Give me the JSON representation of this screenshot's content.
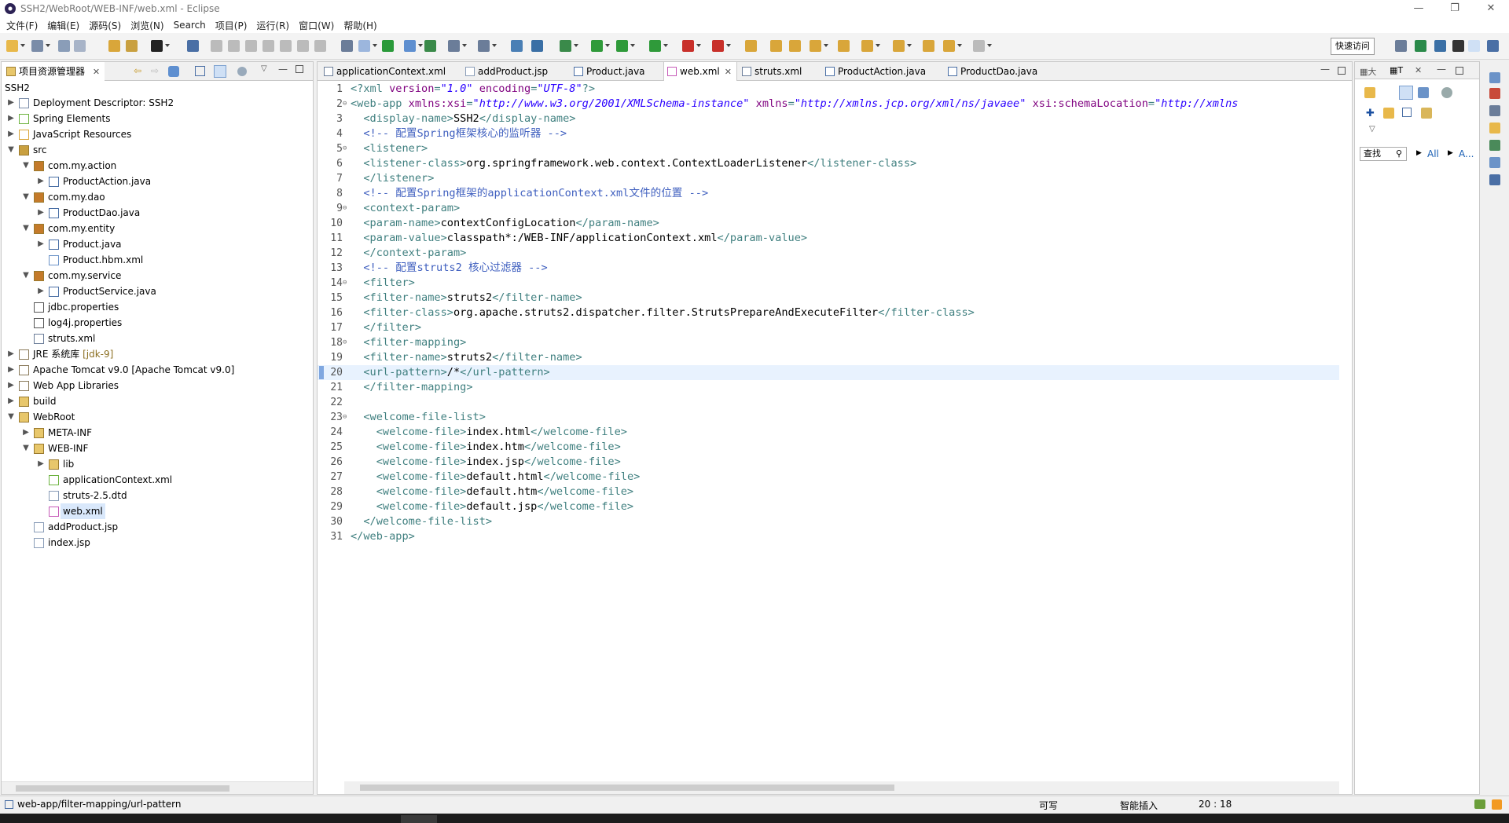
{
  "window": {
    "title": "SSH2/WebRoot/WEB-INF/web.xml - Eclipse"
  },
  "menu": [
    "文件(F)",
    "编辑(E)",
    "源码(S)",
    "浏览(N)",
    "Search",
    "项目(P)",
    "运行(R)",
    "窗口(W)",
    "帮助(H)"
  ],
  "toolbar": {
    "quick_access": "快速访问"
  },
  "explorer": {
    "tab_label": "项目资源管理器",
    "root": "SSH2",
    "items": [
      {
        "label": "Deployment Descriptor: SSH2",
        "depth": 0,
        "twisty": "▶",
        "icon": "descriptor-icon"
      },
      {
        "label": "Spring Elements",
        "depth": 0,
        "twisty": "▶",
        "icon": "spring-icon"
      },
      {
        "label": "JavaScript Resources",
        "depth": 0,
        "twisty": "▶",
        "icon": "js-resources-icon"
      },
      {
        "label": "src",
        "depth": 0,
        "twisty": "▼",
        "icon": "source-folder-icon"
      },
      {
        "label": "com.my.action",
        "depth": 1,
        "twisty": "▼",
        "icon": "package-icon"
      },
      {
        "label": "ProductAction.java",
        "depth": 2,
        "twisty": "▶",
        "icon": "java-file-icon"
      },
      {
        "label": "com.my.dao",
        "depth": 1,
        "twisty": "▼",
        "icon": "package-icon"
      },
      {
        "label": "ProductDao.java",
        "depth": 2,
        "twisty": "▶",
        "icon": "java-file-icon"
      },
      {
        "label": "com.my.entity",
        "depth": 1,
        "twisty": "▼",
        "icon": "package-icon"
      },
      {
        "label": "Product.java",
        "depth": 2,
        "twisty": "▶",
        "icon": "java-file-icon"
      },
      {
        "label": "Product.hbm.xml",
        "depth": 2,
        "twisty": "",
        "icon": "hbm-file-icon"
      },
      {
        "label": "com.my.service",
        "depth": 1,
        "twisty": "▼",
        "icon": "package-icon"
      },
      {
        "label": "ProductService.java",
        "depth": 2,
        "twisty": "▶",
        "icon": "java-file-icon"
      },
      {
        "label": "jdbc.properties",
        "depth": 1,
        "twisty": "",
        "icon": "properties-file-icon"
      },
      {
        "label": "log4j.properties",
        "depth": 1,
        "twisty": "",
        "icon": "properties-file-icon"
      },
      {
        "label": "struts.xml",
        "depth": 1,
        "twisty": "",
        "icon": "xml-file-icon"
      },
      {
        "label": "JRE 系统库",
        "deco": " [jdk-9]",
        "depth": 0,
        "twisty": "▶",
        "icon": "library-icon"
      },
      {
        "label": "Apache Tomcat v9.0 [Apache Tomcat v9.0]",
        "depth": 0,
        "twisty": "▶",
        "icon": "library-icon"
      },
      {
        "label": "Web App Libraries",
        "depth": 0,
        "twisty": "▶",
        "icon": "library-icon"
      },
      {
        "label": "build",
        "depth": 0,
        "twisty": "▶",
        "icon": "folder-icon"
      },
      {
        "label": "WebRoot",
        "depth": 0,
        "twisty": "▼",
        "icon": "web-folder-icon"
      },
      {
        "label": "META-INF",
        "depth": 1,
        "twisty": "▶",
        "icon": "folder-icon"
      },
      {
        "label": "WEB-INF",
        "depth": 1,
        "twisty": "▼",
        "icon": "folder-icon"
      },
      {
        "label": "lib",
        "depth": 2,
        "twisty": "▶",
        "icon": "folder-icon"
      },
      {
        "label": "applicationContext.xml",
        "depth": 2,
        "twisty": "",
        "icon": "spring-xml-icon"
      },
      {
        "label": "struts-2.5.dtd",
        "depth": 2,
        "twisty": "",
        "icon": "dtd-file-icon"
      },
      {
        "label": "web.xml",
        "depth": 2,
        "twisty": "",
        "icon": "web-xml-icon",
        "selected": true
      },
      {
        "label": "addProduct.jsp",
        "depth": 1,
        "twisty": "",
        "icon": "jsp-file-icon"
      },
      {
        "label": "index.jsp",
        "depth": 1,
        "twisty": "",
        "icon": "jsp-file-icon"
      }
    ]
  },
  "editor": {
    "tabs": [
      {
        "label": "applicationContext.xml",
        "icon": "xml-file-icon"
      },
      {
        "label": "addProduct.jsp",
        "icon": "jsp-file-icon"
      },
      {
        "label": "Product.java",
        "icon": "java-file-icon"
      },
      {
        "label": "web.xml",
        "icon": "web-xml-icon",
        "active": true
      },
      {
        "label": "struts.xml",
        "icon": "xml-file-icon"
      },
      {
        "label": "ProductAction.java",
        "icon": "java-file-icon"
      },
      {
        "label": "ProductDao.java",
        "icon": "java-file-icon"
      }
    ],
    "current_line": 20,
    "lines": [
      {
        "n": "1",
        "fold": "",
        "seg": [
          [
            "pi",
            "<?xml "
          ],
          [
            "attr",
            "version"
          ],
          [
            "pi",
            "="
          ],
          [
            "val",
            "\"1.0\""
          ],
          [
            "pi",
            " "
          ],
          [
            "attr",
            "encoding"
          ],
          [
            "pi",
            "="
          ],
          [
            "val",
            "\"UTF-8\""
          ],
          [
            "pi",
            "?>"
          ]
        ]
      },
      {
        "n": "2",
        "fold": "⊖",
        "seg": [
          [
            "tag",
            "<web-app "
          ],
          [
            "attr",
            "xmlns:xsi"
          ],
          [
            "tag",
            "="
          ],
          [
            "val",
            "\"http://www.w3.org/2001/XMLSchema-instance\""
          ],
          [
            "tag",
            " "
          ],
          [
            "attr",
            "xmlns"
          ],
          [
            "tag",
            "="
          ],
          [
            "val",
            "\"http://xmlns.jcp.org/xml/ns/javaee\""
          ],
          [
            "tag",
            " "
          ],
          [
            "attr",
            "xsi:schemaLocation"
          ],
          [
            "tag",
            "="
          ],
          [
            "val",
            "\"http://xmlns"
          ]
        ]
      },
      {
        "n": "3",
        "fold": "",
        "seg": [
          [
            "txt",
            "  "
          ],
          [
            "tag",
            "<display-name>"
          ],
          [
            "txt",
            "SSH2"
          ],
          [
            "tag",
            "</display-name>"
          ]
        ]
      },
      {
        "n": "4",
        "fold": "",
        "seg": [
          [
            "txt",
            "  "
          ],
          [
            "com",
            "<!-- 配置Spring框架核心的监听器 -->"
          ]
        ]
      },
      {
        "n": "5",
        "fold": "⊖",
        "seg": [
          [
            "txt",
            "  "
          ],
          [
            "tag",
            "<listener>"
          ]
        ]
      },
      {
        "n": "6",
        "fold": "",
        "seg": [
          [
            "txt",
            "  "
          ],
          [
            "tag",
            "<listener-class>"
          ],
          [
            "txt",
            "org.springframework.web.context.ContextLoaderListener"
          ],
          [
            "tag",
            "</listener-class>"
          ]
        ]
      },
      {
        "n": "7",
        "fold": "",
        "seg": [
          [
            "txt",
            "  "
          ],
          [
            "tag",
            "</listener>"
          ]
        ]
      },
      {
        "n": "8",
        "fold": "",
        "seg": [
          [
            "txt",
            "  "
          ],
          [
            "com",
            "<!-- 配置Spring框架的applicationContext.xml文件的位置 -->"
          ]
        ]
      },
      {
        "n": "9",
        "fold": "⊖",
        "seg": [
          [
            "txt",
            "  "
          ],
          [
            "tag",
            "<context-param>"
          ]
        ]
      },
      {
        "n": "10",
        "fold": "",
        "seg": [
          [
            "txt",
            "  "
          ],
          [
            "tag",
            "<param-name>"
          ],
          [
            "txt",
            "contextConfigLocation"
          ],
          [
            "tag",
            "</param-name>"
          ]
        ]
      },
      {
        "n": "11",
        "fold": "",
        "seg": [
          [
            "txt",
            "  "
          ],
          [
            "tag",
            "<param-value>"
          ],
          [
            "txt",
            "classpath*:/WEB-INF/applicationContext.xml"
          ],
          [
            "tag",
            "</param-value>"
          ]
        ]
      },
      {
        "n": "12",
        "fold": "",
        "seg": [
          [
            "txt",
            "  "
          ],
          [
            "tag",
            "</context-param>"
          ]
        ]
      },
      {
        "n": "13",
        "fold": "",
        "seg": [
          [
            "txt",
            "  "
          ],
          [
            "com",
            "<!-- 配置struts2 核心过滤器 -->"
          ]
        ]
      },
      {
        "n": "14",
        "fold": "⊖",
        "seg": [
          [
            "txt",
            "  "
          ],
          [
            "tag",
            "<filter>"
          ]
        ]
      },
      {
        "n": "15",
        "fold": "",
        "seg": [
          [
            "txt",
            "  "
          ],
          [
            "tag",
            "<filter-name>"
          ],
          [
            "txt",
            "struts2"
          ],
          [
            "tag",
            "</filter-name>"
          ]
        ]
      },
      {
        "n": "16",
        "fold": "",
        "seg": [
          [
            "txt",
            "  "
          ],
          [
            "tag",
            "<filter-class>"
          ],
          [
            "txt",
            "org.apache.struts2.dispatcher.filter.StrutsPrepareAndExecuteFilter"
          ],
          [
            "tag",
            "</filter-class>"
          ]
        ]
      },
      {
        "n": "17",
        "fold": "",
        "seg": [
          [
            "txt",
            "  "
          ],
          [
            "tag",
            "</filter>"
          ]
        ]
      },
      {
        "n": "18",
        "fold": "⊖",
        "seg": [
          [
            "txt",
            "  "
          ],
          [
            "tag",
            "<filter-mapping>"
          ]
        ]
      },
      {
        "n": "19",
        "fold": "",
        "seg": [
          [
            "txt",
            "  "
          ],
          [
            "tag",
            "<filter-name>"
          ],
          [
            "txt",
            "struts2"
          ],
          [
            "tag",
            "</filter-name>"
          ]
        ]
      },
      {
        "n": "20",
        "fold": "",
        "seg": [
          [
            "txt",
            "  "
          ],
          [
            "tag",
            "<url-pattern>"
          ],
          [
            "txt",
            "/*"
          ],
          [
            "tag",
            "</url-pattern>"
          ]
        ]
      },
      {
        "n": "21",
        "fold": "",
        "seg": [
          [
            "txt",
            "  "
          ],
          [
            "tag",
            "</filter-mapping>"
          ]
        ]
      },
      {
        "n": "22",
        "fold": "",
        "seg": []
      },
      {
        "n": "23",
        "fold": "⊖",
        "seg": [
          [
            "txt",
            "  "
          ],
          [
            "tag",
            "<welcome-file-list>"
          ]
        ]
      },
      {
        "n": "24",
        "fold": "",
        "seg": [
          [
            "txt",
            "    "
          ],
          [
            "tag",
            "<welcome-file>"
          ],
          [
            "txt",
            "index.html"
          ],
          [
            "tag",
            "</welcome-file>"
          ]
        ]
      },
      {
        "n": "25",
        "fold": "",
        "seg": [
          [
            "txt",
            "    "
          ],
          [
            "tag",
            "<welcome-file>"
          ],
          [
            "txt",
            "index.htm"
          ],
          [
            "tag",
            "</welcome-file>"
          ]
        ]
      },
      {
        "n": "26",
        "fold": "",
        "seg": [
          [
            "txt",
            "    "
          ],
          [
            "tag",
            "<welcome-file>"
          ],
          [
            "txt",
            "index.jsp"
          ],
          [
            "tag",
            "</welcome-file>"
          ]
        ]
      },
      {
        "n": "27",
        "fold": "",
        "seg": [
          [
            "txt",
            "    "
          ],
          [
            "tag",
            "<welcome-file>"
          ],
          [
            "txt",
            "default.html"
          ],
          [
            "tag",
            "</welcome-file>"
          ]
        ]
      },
      {
        "n": "28",
        "fold": "",
        "seg": [
          [
            "txt",
            "    "
          ],
          [
            "tag",
            "<welcome-file>"
          ],
          [
            "txt",
            "default.htm"
          ],
          [
            "tag",
            "</welcome-file>"
          ]
        ]
      },
      {
        "n": "29",
        "fold": "",
        "seg": [
          [
            "txt",
            "    "
          ],
          [
            "tag",
            "<welcome-file>"
          ],
          [
            "txt",
            "default.jsp"
          ],
          [
            "tag",
            "</welcome-file>"
          ]
        ]
      },
      {
        "n": "30",
        "fold": "",
        "seg": [
          [
            "txt",
            "  "
          ],
          [
            "tag",
            "</welcome-file-list>"
          ]
        ]
      },
      {
        "n": "31",
        "fold": "",
        "seg": [
          [
            "tag",
            "</web-app>"
          ]
        ]
      }
    ]
  },
  "outline": {
    "tab1": "大",
    "tab2": "T",
    "find_placeholder": "查找",
    "link_all": "All",
    "link_a": "A..."
  },
  "status": {
    "path": "web-app/filter-mapping/url-pattern",
    "writable": "可写",
    "insert_mode": "智能插入",
    "position": "20 : 18"
  },
  "colors": {
    "tag": "#3f7f7f",
    "attr": "#7f007f",
    "value": "#2a00ff",
    "comment": "#3f5fbf",
    "selection": "#d9e8fb",
    "current_line": "#e8f2fe"
  }
}
